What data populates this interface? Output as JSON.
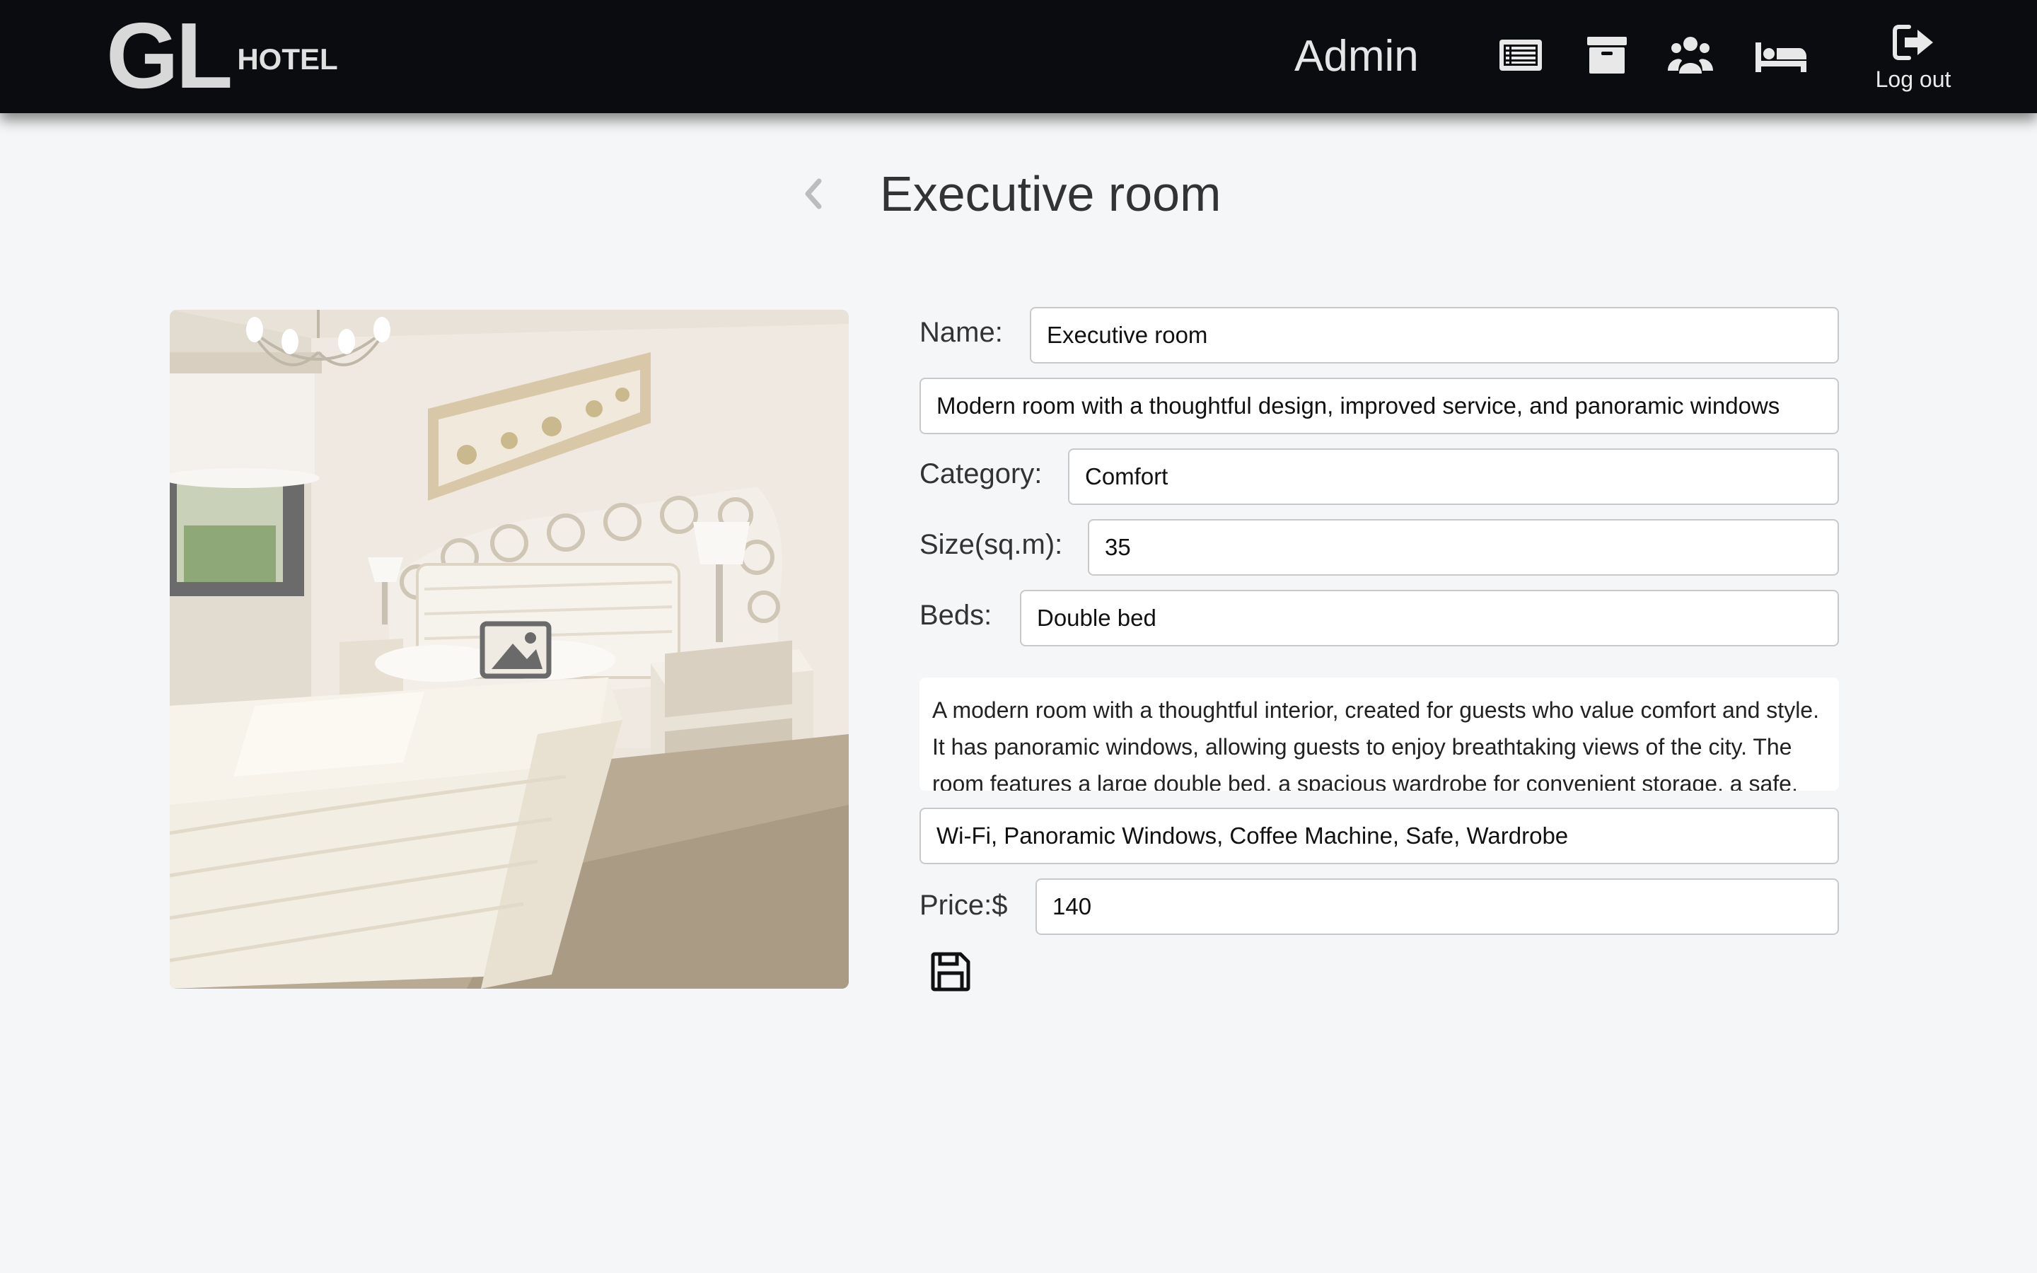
{
  "header": {
    "logo_main": "GL",
    "logo_sub": "HOTEL",
    "user_role": "Admin",
    "nav_icons": [
      "list-icon",
      "archive-icon",
      "users-icon",
      "bed-icon"
    ],
    "logout_label": "Log out"
  },
  "page": {
    "title": "Executive room"
  },
  "form": {
    "name_label": "Name:",
    "name_value": "Executive room",
    "short_description_value": "Modern room with a thoughtful design, improved service, and panoramic windows",
    "category_label": "Category:",
    "category_value": "Comfort",
    "size_label": "Size(sq.m):",
    "size_value": "35",
    "beds_label": "Beds:",
    "beds_value": "Double bed",
    "description_value": "A modern room with a thoughtful interior, created for guests who value comfort and style. It has panoramic windows, allowing guests to enjoy breathtaking views of the city. The room features a large double bed, a spacious wardrobe for convenient storage, a safe,",
    "amenities_value": "Wi-Fi, Panoramic Windows, Coffee Machine, Safe, Wardrobe",
    "price_label": "Price:$",
    "price_value": "140"
  },
  "colors": {
    "header_bg": "#0b0c0f",
    "page_bg": "#f5f6f7"
  }
}
